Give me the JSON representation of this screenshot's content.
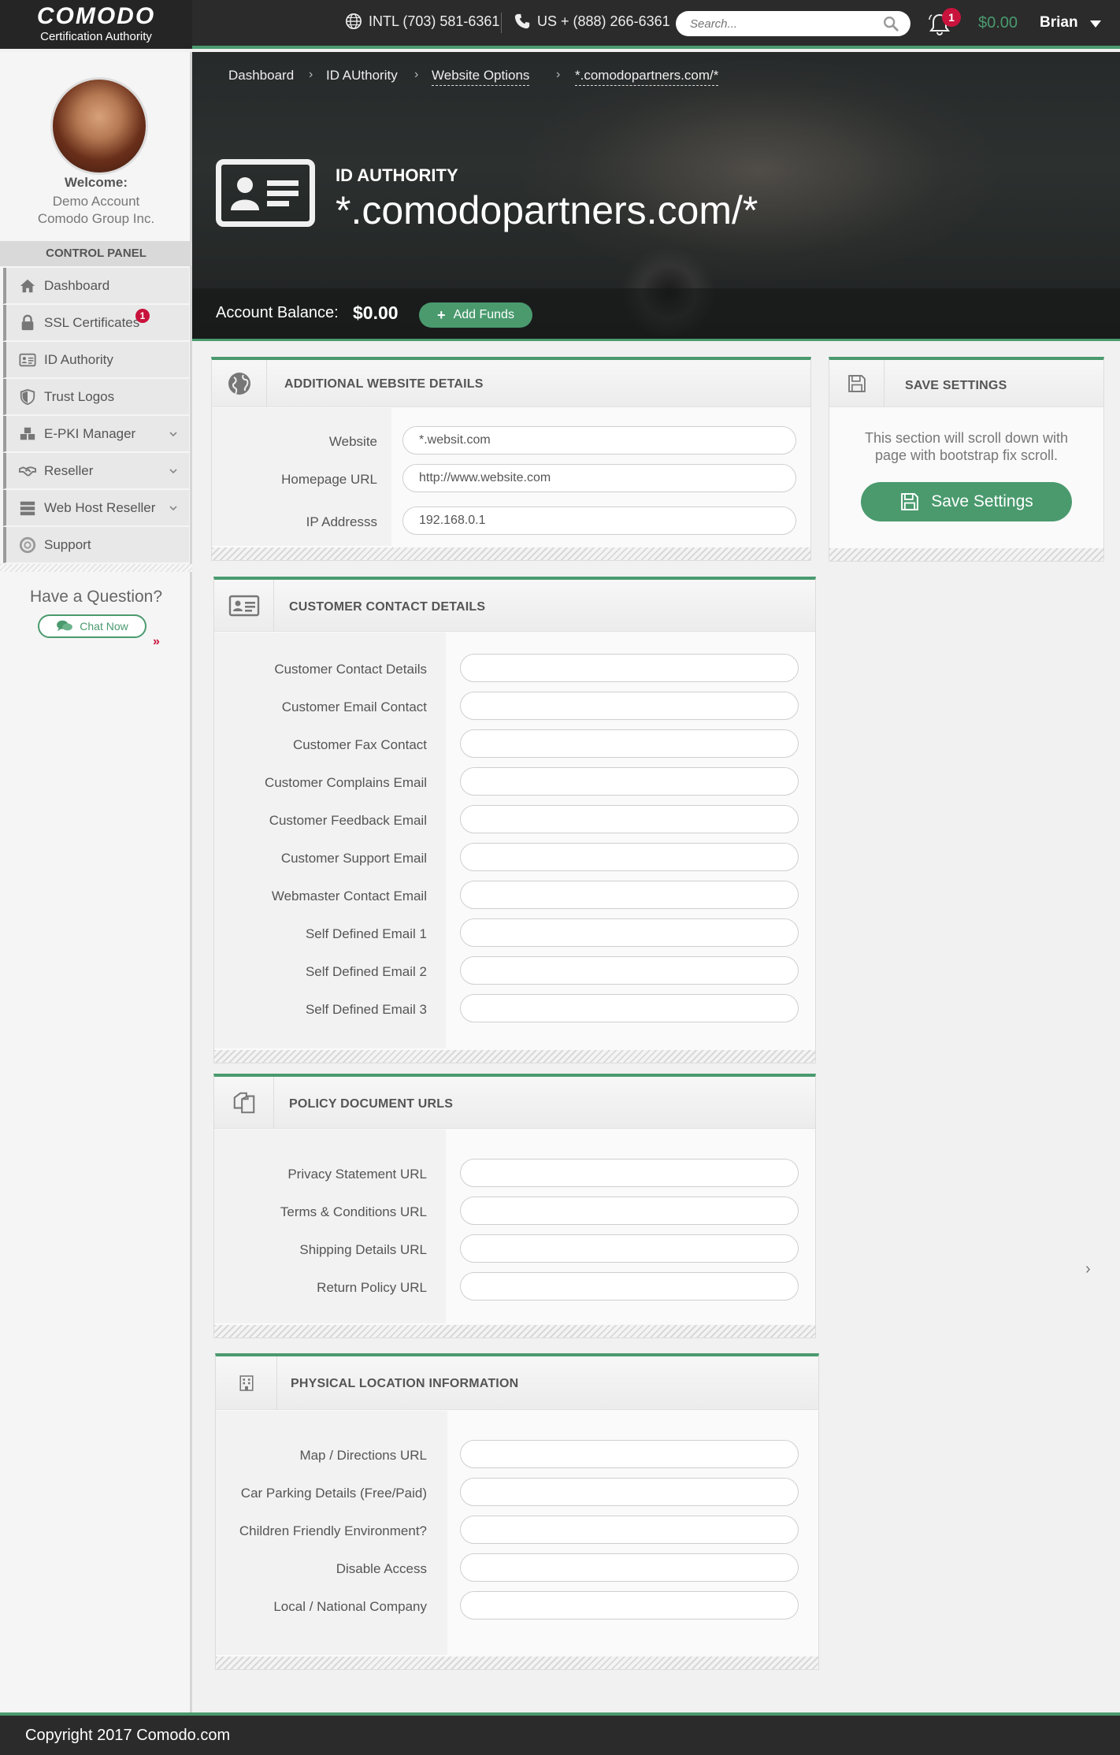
{
  "header": {
    "brand": "COMODO",
    "brand_sub": "Certification Authority",
    "phone_intl": "INTL (703) 581-6361",
    "phone_us": "US + (888) 266-6361",
    "search_placeholder": "Search...",
    "notification_count": "1",
    "balance": "$0.00",
    "user": "Brian"
  },
  "sidebar": {
    "welcome": "Welcome:",
    "account_name": "Demo Account",
    "account_org": "Comodo Group Inc.",
    "control_panel": "CONTROL PANEL",
    "items": [
      {
        "label": "Dashboard",
        "icon": "home-icon"
      },
      {
        "label": "SSL Certificates",
        "icon": "lock-icon",
        "badge": "1"
      },
      {
        "label": "ID Authority",
        "icon": "id-card-icon"
      },
      {
        "label": "Trust Logos",
        "icon": "shield-icon"
      },
      {
        "label": "E-PKI Manager",
        "icon": "cubes-icon"
      },
      {
        "label": "Reseller",
        "icon": "handshake-icon"
      },
      {
        "label": "Web Host Reseller",
        "icon": "server-icon"
      },
      {
        "label": "Support",
        "icon": "lifebuoy-icon"
      }
    ],
    "question": "Have a Question?",
    "chat": "Chat Now",
    "more": "»"
  },
  "hero": {
    "breadcrumb": [
      "Dashboard",
      "ID AUthority",
      "Website Options",
      "*.comodopartners.com/*"
    ],
    "label": "ID AUTHORITY",
    "domain": "*.comodopartners.com/*",
    "balance_label": "Account Balance:",
    "balance_value": "$0.00",
    "add_funds": "Add Funds"
  },
  "panels": {
    "website": {
      "title": "ADDITIONAL WEBSITE DETAILS",
      "fields": [
        {
          "label": "Website",
          "value": "*.websit.com"
        },
        {
          "label": "Homepage URL",
          "value": "http://www.website.com"
        },
        {
          "label": "IP Addresss",
          "value": "192.168.0.1"
        }
      ]
    },
    "save": {
      "title": "SAVE SETTINGS",
      "text_line1": "This section will scroll down with",
      "text_line2": "page with bootstrap fix scroll.",
      "button": "Save Settings"
    },
    "contact": {
      "title": "CUSTOMER CONTACT DETAILS",
      "fields": [
        {
          "label": "Customer Contact Details",
          "value": ""
        },
        {
          "label": "Customer Email Contact",
          "value": ""
        },
        {
          "label": "Customer Fax Contact",
          "value": ""
        },
        {
          "label": "Customer Complains Email",
          "value": ""
        },
        {
          "label": "Customer Feedback Email",
          "value": ""
        },
        {
          "label": "Customer Support Email",
          "value": ""
        },
        {
          "label": "Webmaster Contact Email",
          "value": ""
        },
        {
          "label": "Self Defined Email 1",
          "value": ""
        },
        {
          "label": "Self Defined Email 2",
          "value": ""
        },
        {
          "label": "Self Defined Email 3",
          "value": ""
        }
      ]
    },
    "policy": {
      "title": "POLICY DOCUMENT URLS",
      "fields": [
        {
          "label": "Privacy Statement URL",
          "value": ""
        },
        {
          "label": "Terms & Conditions URL",
          "value": ""
        },
        {
          "label": "Shipping Details URL",
          "value": ""
        },
        {
          "label": "Return Policy URL",
          "value": ""
        }
      ]
    },
    "location": {
      "title": "PHYSICAL LOCATION INFORMATION",
      "fields": [
        {
          "label": "Map / Directions URL",
          "value": ""
        },
        {
          "label": "Car Parking Details (Free/Paid)",
          "value": ""
        },
        {
          "label": "Children Friendly Environment?",
          "value": ""
        },
        {
          "label": "Disable Access",
          "value": ""
        },
        {
          "label": "Local / National Company",
          "value": ""
        }
      ]
    }
  },
  "footer": {
    "copyright": "Copyright 2017 Comodo.com"
  },
  "colors": {
    "accent": "#4a9a6e",
    "badge": "#c8133c",
    "topbar": "#2b2b2b"
  }
}
